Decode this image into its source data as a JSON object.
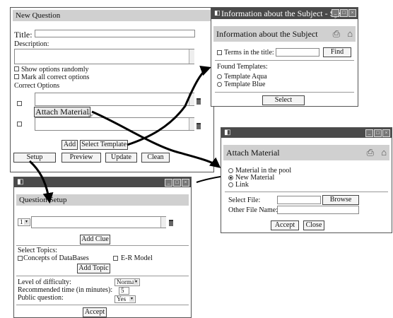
{
  "new_question": {
    "header": "New Question",
    "title_label": "Title:",
    "description_label": "Description:",
    "show_randomly": "Show options randomly",
    "mark_all_correct": "Mark all correct options",
    "correct_options_label": "Correct Options",
    "attach_material_label": "Attach Material",
    "add_label": "Add",
    "select_template_label": "Select Template",
    "setup_label": "Setup",
    "preview_label": "Preview",
    "update_label": "Update",
    "clean_label": "Clean"
  },
  "subject_window": {
    "title": "Information about the Subject - Sys",
    "header": "Information about the Subject",
    "terms_label": "Terms in the title:",
    "find_label": "Find",
    "found_templates_label": "Found Templates:",
    "templates": [
      "Template Aqua",
      "Template Blue"
    ],
    "select_label": "Select"
  },
  "attach_window": {
    "header": "Attach Material",
    "options": [
      "Material in the pool",
      "New Material",
      "Link"
    ],
    "selected_option": "New Material",
    "select_file_label": "Select File:",
    "browse_label": "Browse",
    "other_file_name_label": "Other File Name:",
    "accept_label": "Accept",
    "close_label": "Close"
  },
  "setup_window": {
    "header": "Question Setup",
    "clue_number": "1",
    "add_clue_label": "Add Clue",
    "select_topics_label": "Select Topics:",
    "topics": [
      "Concepts of DataBases",
      "E-R Model"
    ],
    "add_topic_label": "Add Topic",
    "difficulty_label": "Level of difficulty:",
    "difficulty_value": "Normal",
    "time_label": "Recommended time (in minutes):",
    "time_value": "5",
    "public_label": "Public question:",
    "public_value": "Yes",
    "accept_label": "Accept"
  },
  "window_controls": [
    "_",
    "□",
    "×"
  ],
  "icons": [
    "window-app-icon",
    "print-icon",
    "home-icon",
    "trash-icon",
    "hand-cursor-icon"
  ],
  "colors": {
    "titlebar": "#4a4a4a",
    "pane_header": "#d0d0d0",
    "arrow": "#000000"
  }
}
